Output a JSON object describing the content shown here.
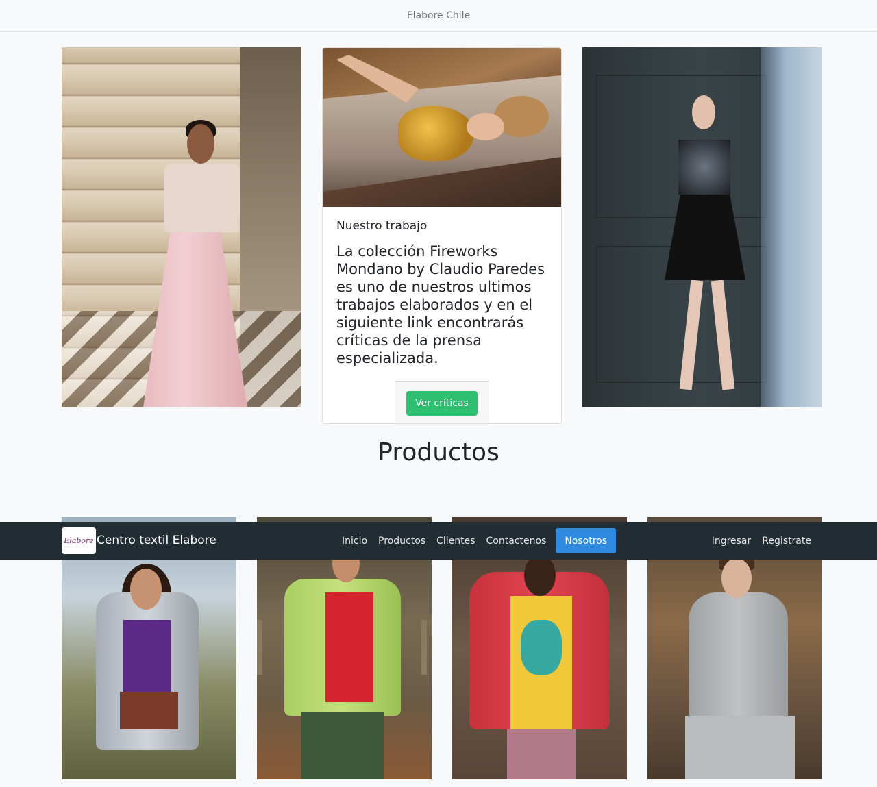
{
  "topbar": {
    "title": "Elabore Chile"
  },
  "hero": {
    "left_photo": "photo-woman-stairs",
    "right_photo": "photo-woman-black-dress",
    "card": {
      "photo": "photo-woman-gold-top",
      "subtitle": "Nuestro trabajo",
      "text": "La colección Fireworks Mondano by Claudio Paredes es uno de nuestros ultimos trabajos elaborados y en el siguiente link encontrarás críticas de la prensa especializada.",
      "button_label": "Ver críticas",
      "button_color": "#2fbf71"
    }
  },
  "products": {
    "title": "Productos",
    "items": [
      "photo-woman-gray-jacket",
      "photo-man-green-jacket",
      "photo-woman-red-jacket",
      "photo-man-gray-hoodie"
    ]
  },
  "navbar": {
    "brand_logo_text": "Elabore",
    "brand": "Centro textil Elabore",
    "links": [
      "Inicio",
      "Productos",
      "Clientes",
      "Contactenos"
    ],
    "active_link": "Nosotros",
    "active_color": "#2f8ae0",
    "right_links": [
      "Ingresar",
      "Registrate"
    ],
    "background": "#212d33"
  }
}
